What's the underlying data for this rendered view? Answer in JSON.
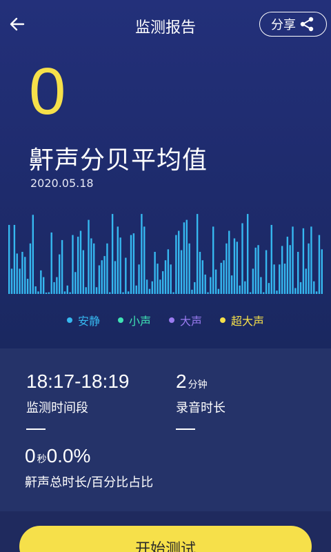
{
  "header": {
    "title": "监测报告",
    "share_label": "分享"
  },
  "summary": {
    "value": "0",
    "title": "鼾声分贝平均值",
    "date": "2020.05.18"
  },
  "chart_data": {
    "type": "bar",
    "values": [
      0.82,
      0.3,
      0.82,
      0.48,
      0.3,
      0.5,
      0.44,
      0.18,
      0.6,
      0.94,
      0.09,
      0.03,
      0.28,
      0.2,
      0,
      0.02,
      0.73,
      0.14,
      0.2,
      0.47,
      0.64,
      0.03,
      0.1,
      0.02,
      0.7,
      0.26,
      0.68,
      0.75,
      0.52,
      0.08,
      0.88,
      0.66,
      0.6,
      0.08,
      0.34,
      0.4,
      0.45,
      0.6,
      0.02,
      0.95,
      0.39,
      0.8,
      0.67,
      0.02,
      0.43,
      0.03,
      0.7,
      0.72,
      0.1,
      0.35,
      0.95,
      0.8,
      0.17,
      0.06,
      0.15,
      0.5,
      0.36,
      0.17,
      0.27,
      0.4,
      0.53,
      0.35,
      0.02,
      0.7,
      0.75,
      0.52,
      0.85,
      0.88,
      0.6,
      0.05,
      0.14,
      0.95,
      0.5,
      0.4,
      0.23,
      0.02,
      0.2,
      0.8,
      0.29,
      0.06,
      0.37,
      0.4,
      0.6,
      0.75,
      0.22,
      0.66,
      0.62,
      0.1,
      0.84,
      0.15,
      0.95,
      0.02,
      0.3,
      0.55,
      0.58,
      0.2,
      0.02,
      0.52,
      0.13,
      0.82,
      0.35,
      0.04,
      0.35,
      0.57,
      0.36,
      0.68,
      0.58,
      0.8,
      0.07,
      0.5,
      0.14,
      0.78,
      0.3,
      0.6,
      0.8,
      0.15,
      0.03,
      0.7,
      0.53
    ],
    "bar_color": "#36b8f0",
    "legend": [
      {
        "label": "安静",
        "color": "#36b8f0"
      },
      {
        "label": "小声",
        "color": "#3fe3b4"
      },
      {
        "label": "大声",
        "color": "#9a7bf0"
      },
      {
        "label": "超大声",
        "color": "#f6e04a"
      }
    ]
  },
  "stats": {
    "time_range_value": "18:17-18:19",
    "time_range_label": "监测时间段",
    "duration_value": "2",
    "duration_unit": "分钟",
    "duration_label": "录音时长",
    "snore_seconds": "0",
    "snore_seconds_unit": "秒",
    "snore_percent": "0.0%",
    "snore_label": "鼾声总时长/百分比占比"
  },
  "actions": {
    "start_label": "开始测试"
  },
  "colors": {
    "accent_yellow": "#f6e04a",
    "background": "#1f2a5e",
    "panel": "#253369"
  }
}
